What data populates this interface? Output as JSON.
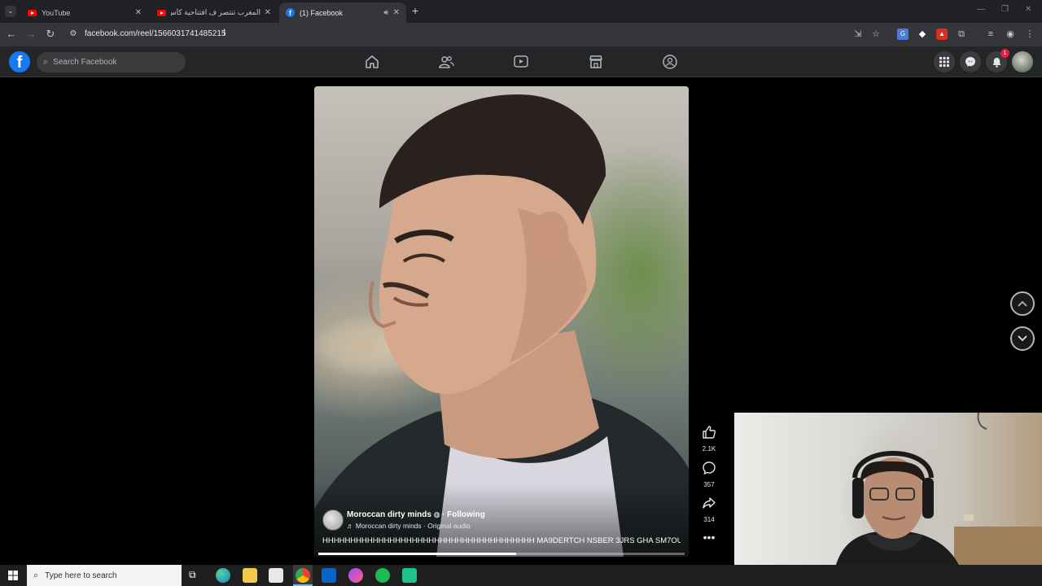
{
  "browser": {
    "tabs": [
      {
        "label": "YouTube",
        "favicon": "youtube-icon",
        "active": false
      },
      {
        "label": "المغرب تنتصر ف افتتاحية كأس الأ",
        "favicon": "youtube-icon",
        "active": false
      },
      {
        "label": "(1) Facebook",
        "favicon": "facebook-icon",
        "active": true
      }
    ],
    "url": "facebook.com/reel/1566031741485215"
  },
  "facebook": {
    "logo": "f",
    "search_placeholder": "Search Facebook",
    "notification_count": "1"
  },
  "reel": {
    "author": "Moroccan dirty minds",
    "following": "· Following",
    "audio": "Moroccan dirty minds · Original audio",
    "caption": "HHHHHHHHHHHHHHHHHHHHHHHHHHHHHHHHHHHHHH MA9DERTCH NSBER 3JRS GHA SM7OULI",
    "progress": 0.54,
    "likes": "2.1K",
    "comments": "357",
    "shares": "314"
  },
  "taskbar": {
    "search_placeholder": "Type here to search"
  },
  "colors": {
    "facebook_blue": "#1877f2",
    "chrome_dark": "#202124",
    "badge_red": "#e41e3f"
  }
}
